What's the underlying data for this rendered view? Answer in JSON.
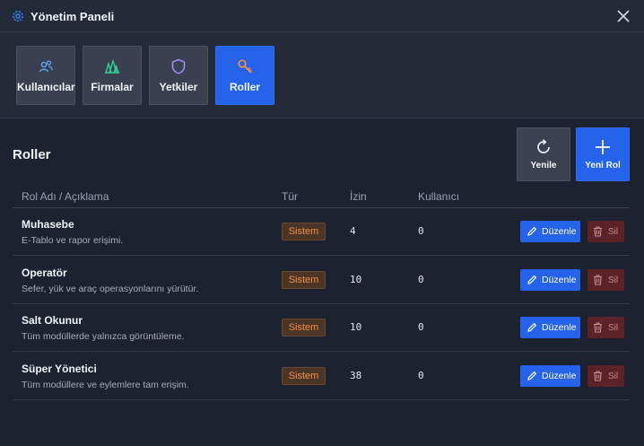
{
  "window": {
    "title": "Yönetim Paneli"
  },
  "tabs": [
    {
      "label": "Kullanıcılar",
      "icon": "users-icon"
    },
    {
      "label": "Firmalar",
      "icon": "company-icon"
    },
    {
      "label": "Yetkiler",
      "icon": "shield-icon"
    },
    {
      "label": "Roller",
      "icon": "key-icon",
      "active": true
    }
  ],
  "section": {
    "title": "Roller",
    "refresh_label": "Yenile",
    "new_label": "Yeni Rol"
  },
  "table": {
    "headers": {
      "name": "Rol Adı / Açıklama",
      "type": "Tür",
      "perm": "İzin",
      "users": "Kullanıcı"
    },
    "edit_label": "Düzenle",
    "delete_label": "Sil",
    "rows": [
      {
        "name": "Muhasebe",
        "desc": "E-Tablo ve rapor erişimi.",
        "type": "Sistem",
        "perm": "4",
        "users": "0"
      },
      {
        "name": "Operatör",
        "desc": "Sefer, yük ve araç operasyonlarını yürütür.",
        "type": "Sistem",
        "perm": "10",
        "users": "0"
      },
      {
        "name": "Salt Okunur",
        "desc": "Tüm modüllerde yalnızca görüntüleme.",
        "type": "Sistem",
        "perm": "10",
        "users": "0"
      },
      {
        "name": "Süper Yönetici",
        "desc": "Tüm modüllere ve eylemlere tam erişim.",
        "type": "Sistem",
        "perm": "38",
        "users": "0"
      }
    ]
  },
  "colors": {
    "accent": "#2563eb",
    "badge_text": "#f2904a",
    "danger": "#5b2328"
  }
}
